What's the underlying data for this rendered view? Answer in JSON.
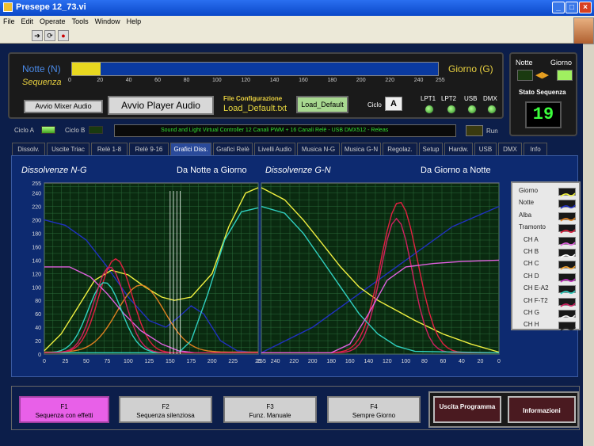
{
  "window": {
    "title": "Presepe 12_73.vi"
  },
  "menu": [
    "File",
    "Edit",
    "Operate",
    "Tools",
    "Window",
    "Help"
  ],
  "top": {
    "notte_label": "Notte (N)",
    "giorno_label": "Giorno (G)",
    "sequenza_label": "Sequenza",
    "slider_ticks": [
      "0",
      "20",
      "40",
      "60",
      "80",
      "100",
      "120",
      "140",
      "160",
      "180",
      "200",
      "220",
      "240",
      "255"
    ],
    "slider_value": 20,
    "avvio_mixer": "Avvio Mixer Audio",
    "avvio_player": "Avvio Player Audio",
    "file_config_label": "File Configurazione",
    "file_config_value": "Load_Default.txt",
    "load_default_btn": "Load_Default",
    "ciclo_label": "Ciclo",
    "ciclo_value": "A",
    "ports": [
      "LPT1",
      "LPT2",
      "USB",
      "DMX"
    ]
  },
  "right": {
    "notte": "Notte",
    "giorno": "Giorno",
    "stato_label": "Stato Sequenza",
    "stato_value": "19"
  },
  "row2": {
    "ciclo_a": "Ciclo A",
    "ciclo_b": "Ciclo B",
    "ticker": "Sound and Light Virtual Controller 12 Canali PWM + 16 Canali Relè - USB DMX512 - Releas",
    "run": "Run"
  },
  "tabs": [
    "Dissolv.",
    "Uscite Triac",
    "Relè 1-8",
    "Relè 9-16",
    "Grafici Diss.",
    "Grafici Relè",
    "Livelli Audio",
    "Musica N-G",
    "Musica G-N",
    "Regolaz.",
    "Setup",
    "Hardw.",
    "USB",
    "DMX",
    "Info"
  ],
  "graph_left": {
    "title": "Dissolvenze N-G",
    "subtitle": "Da Notte a Giorno",
    "y_ticks": [
      "0",
      "20",
      "40",
      "60",
      "80",
      "100",
      "120",
      "140",
      "160",
      "180",
      "200",
      "220",
      "240",
      "255"
    ],
    "x_ticks": [
      "0",
      "25",
      "50",
      "75",
      "100",
      "125",
      "150",
      "175",
      "200",
      "225",
      "25"
    ]
  },
  "graph_right": {
    "title": "Dissolvenze G-N",
    "subtitle": "Da Giorno a Notte",
    "x_ticks": [
      "255",
      "240",
      "220",
      "200",
      "180",
      "160",
      "140",
      "120",
      "100",
      "80",
      "60",
      "40",
      "20",
      "0"
    ]
  },
  "legend": [
    {
      "name": "Giorno",
      "color": "#f0f040"
    },
    {
      "name": "Notte",
      "color": "#2030c0"
    },
    {
      "name": "Alba",
      "color": "#e08020"
    },
    {
      "name": "Tramonto",
      "color": "#e02040"
    },
    {
      "name": "CH A",
      "color": "#e060e0"
    },
    {
      "name": "CH B",
      "color": "#ffffff"
    },
    {
      "name": "CH C",
      "color": "#f0a030"
    },
    {
      "name": "CH D",
      "color": "#c030c0"
    },
    {
      "name": "CH E-A2",
      "color": "#30d0c0"
    },
    {
      "name": "CH F-T2",
      "color": "#d02060"
    },
    {
      "name": "CH G",
      "color": "#f0f0f0"
    },
    {
      "name": "CH H",
      "color": "#202020"
    }
  ],
  "bottom": [
    {
      "key": "F1",
      "label": "Sequenza con effetti"
    },
    {
      "key": "F2",
      "label": "Sequenza silenziosa"
    },
    {
      "key": "F3",
      "label": "Funz. Manuale"
    },
    {
      "key": "F4",
      "label": "Sempre Giorno"
    }
  ],
  "uscita": "Uscita Programma",
  "informazioni": "Informazioni"
}
